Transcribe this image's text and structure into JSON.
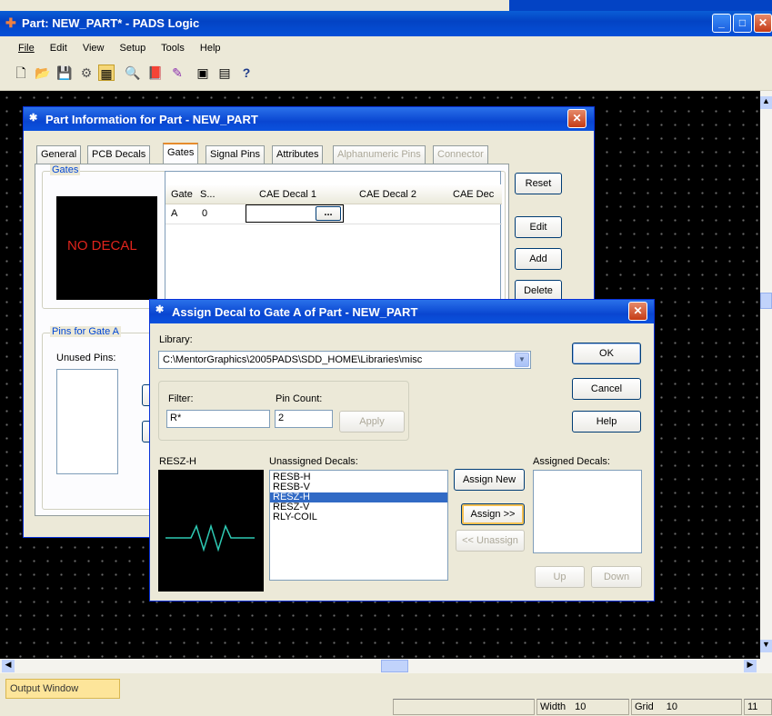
{
  "window": {
    "title": "Part: NEW_PART* - PADS Logic",
    "menu": [
      "File",
      "Edit",
      "View",
      "Setup",
      "Tools",
      "Help"
    ],
    "toolbar_icons": [
      "new-file-icon",
      "open-folder-icon",
      "save-icon",
      "pcb-link-icon",
      "part-editor-icon",
      "zoom-icon",
      "library-icon",
      "eraser-icon",
      "report-icon",
      "window-icon",
      "help-icon"
    ],
    "help_glyph": "?"
  },
  "part_dialog": {
    "title": "Part Information for Part - NEW_PART",
    "tabs": [
      "General",
      "PCB Decals",
      "Gates",
      "Signal Pins",
      "Attributes",
      "Alphanumeric Pins",
      "Connector"
    ],
    "gates_group": "Gates",
    "no_decal": "NO DECAL",
    "table": {
      "columns": [
        "Gate",
        "S...",
        "CAE Decal 1",
        "CAE Decal 2",
        "CAE Dec"
      ],
      "row": [
        "A",
        "0",
        "",
        ""
      ],
      "browse": "..."
    },
    "buttons": [
      "Reset",
      "Edit",
      "Add",
      "Delete"
    ],
    "pins_group": "Pins for Gate A",
    "unused_pins": "Unused Pins:"
  },
  "assign_dialog": {
    "title": "Assign Decal to Gate A of Part - NEW_PART",
    "library_label": "Library:",
    "library_value": "C:\\MentorGraphics\\2005PADS\\SDD_HOME\\Libraries\\misc",
    "filter_label": "Filter:",
    "filter_value": "R*",
    "pincount_label": "Pin Count:",
    "pincount_value": "2",
    "apply": "Apply",
    "ok": "OK",
    "cancel": "Cancel",
    "help": "Help",
    "preview_label": "RESZ-H",
    "unassigned_label": "Unassigned Decals:",
    "unassigned": [
      "RESB-H",
      "RESB-V",
      "RESZ-H",
      "RESZ-V",
      "RLY-COIL"
    ],
    "selected_index": 2,
    "assign_new": "Assign New",
    "assign": "Assign >>",
    "unassign": "<< Unassign",
    "assigned_label": "Assigned Decals:",
    "up": "Up",
    "down": "Down"
  },
  "output_tab": "Output Window",
  "status": {
    "width_label": "Width",
    "width_value": "10",
    "grid_label": "Grid",
    "grid_value": "10",
    "extra": "11"
  }
}
